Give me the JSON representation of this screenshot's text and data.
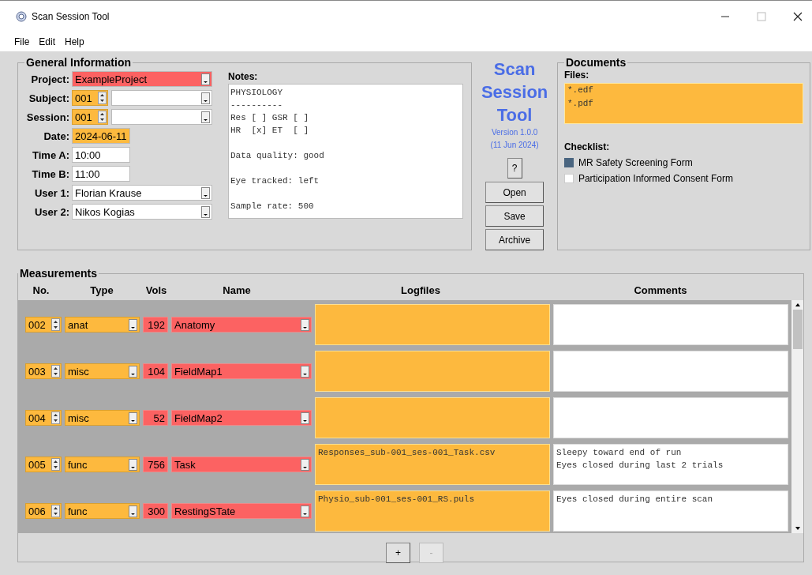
{
  "window": {
    "title": "Scan Session Tool"
  },
  "menu": [
    "File",
    "Edit",
    "Help"
  ],
  "general": {
    "title": "General Information",
    "fields": [
      {
        "label": "Project:",
        "kind": "combo",
        "value": "ExampleProject",
        "color": "#fc6262"
      },
      {
        "label": "Subject:",
        "kind": "spin-combo",
        "value": "001",
        "color": "#fdb93e"
      },
      {
        "label": "Session:",
        "kind": "spin-combo",
        "value": "001",
        "color": "#fdb93e"
      },
      {
        "label": "Date:",
        "kind": "text",
        "value": "2024-06-11",
        "color": "#fdb93e"
      },
      {
        "label": "Time A:",
        "kind": "text",
        "value": "10:00",
        "color": "#ffffff"
      },
      {
        "label": "Time B:",
        "kind": "text",
        "value": "11:00",
        "color": "#ffffff"
      },
      {
        "label": "User 1:",
        "kind": "combo",
        "value": "Florian Krause",
        "color": "#ffffff"
      },
      {
        "label": "User 2:",
        "kind": "combo",
        "value": "Nikos Kogias",
        "color": "#ffffff"
      }
    ],
    "notes_label": "Notes:",
    "notes": "PHYSIOLOGY\n----------\nRes [ ] GSR [ ]\nHR  [x] ET  [ ]\n\nData quality: good\n\nEye tracked: left\n\nSample rate: 500"
  },
  "app": {
    "name": "Scan Session Tool",
    "version": "Version 1.0.0",
    "date": "(11 Jun 2024)",
    "help_button": "?",
    "buttons": [
      "Open",
      "Save",
      "Archive"
    ]
  },
  "documents": {
    "title": "Documents",
    "files_label": "Files:",
    "files": [
      "*.edf",
      "*.pdf"
    ],
    "checklist_label": "Checklist:",
    "checklist": [
      {
        "label": "MR Safety Screening Form",
        "checked": true
      },
      {
        "label": "Participation Informed Consent Form",
        "checked": false
      }
    ]
  },
  "measurements": {
    "title": "Measurements",
    "columns": [
      "No.",
      "Type",
      "Vols",
      "Name",
      "Logfiles",
      "Comments"
    ],
    "rows": [
      {
        "no": "002",
        "type": "anat",
        "vols": "192",
        "name": "Anatomy"
      },
      {
        "no": "003",
        "type": "misc",
        "vols": "104",
        "name": "FieldMap1"
      },
      {
        "no": "004",
        "type": "misc",
        "vols": "52",
        "name": "FieldMap2"
      },
      {
        "no": "005",
        "type": "func",
        "vols": "756",
        "name": "Task",
        "logfile": "Responses_sub-001_ses-001_Task.csv",
        "comments": "Sleepy toward end of run\nEyes closed during last 2 trials"
      },
      {
        "no": "006",
        "type": "func",
        "vols": "300",
        "name": "RestingSTate",
        "logfile": "Physio_sub-001_ses-001_RS.puls",
        "comments": "Eyes closed during entire scan"
      }
    ],
    "buttons": [
      {
        "label": "+",
        "disabled": false
      },
      {
        "label": "-",
        "disabled": true
      }
    ]
  }
}
